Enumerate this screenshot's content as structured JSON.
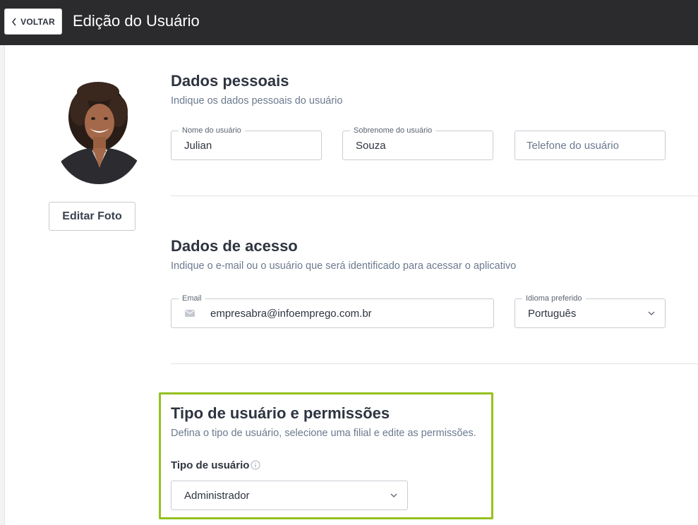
{
  "header": {
    "back_label": "VOLTAR",
    "title": "Edição do Usuário"
  },
  "profile": {
    "edit_photo_label": "Editar Foto"
  },
  "personal": {
    "title": "Dados pessoais",
    "subtitle": "Indique os dados pessoais do usuário",
    "first_name": {
      "label": "Nome do usuário",
      "value": "Julian"
    },
    "last_name": {
      "label": "Sobrenome do usuário",
      "value": "Souza"
    },
    "phone": {
      "placeholder": "Telefone do usuário"
    }
  },
  "access": {
    "title": "Dados de acesso",
    "subtitle": "Indique o e-mail ou o usuário que será identificado para acessar o aplicativo",
    "email": {
      "label": "Email",
      "value": "empresabra@infoemprego.com.br",
      "icon": "mail-icon"
    },
    "language": {
      "label": "Idioma preferido",
      "value": "Português"
    }
  },
  "permissions": {
    "title": "Tipo de usuário e permissões",
    "subtitle": "Defina o tipo de usuário, selecione uma filial e edite as permissões.",
    "user_type_label": "Tipo de usuário",
    "user_type_value": "Administrador"
  },
  "colors": {
    "header_bg": "#2b2b2d",
    "highlight": "#94c11f",
    "muted_text": "#6b7a8f"
  }
}
